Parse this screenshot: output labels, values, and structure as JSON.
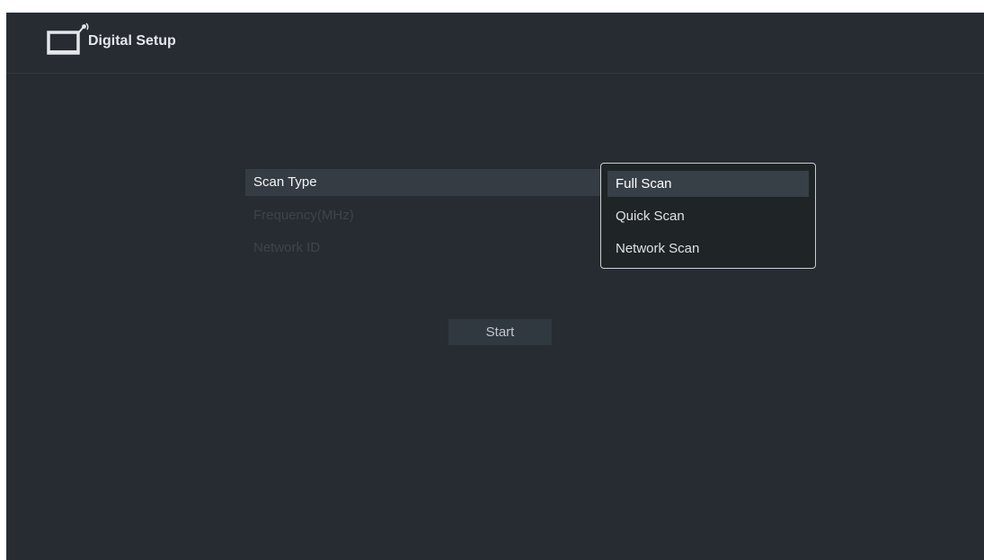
{
  "header": {
    "title": "Digital Setup",
    "icon": "tv-antenna-icon"
  },
  "menu": {
    "items": [
      {
        "label": "Scan Type",
        "state": "selected"
      },
      {
        "label": "Frequency(MHz)",
        "state": "disabled"
      },
      {
        "label": "Network ID",
        "state": "disabled"
      }
    ]
  },
  "dropdown": {
    "options": [
      {
        "label": "Full Scan",
        "selected": true
      },
      {
        "label": "Quick Scan",
        "selected": false
      },
      {
        "label": "Network Scan",
        "selected": false
      }
    ]
  },
  "start_button": {
    "label": "Start"
  },
  "colors": {
    "background": "#272c33",
    "selected_row": "#363c43",
    "dropdown_bg": "#1f2427",
    "dropdown_border": "#c9ced2"
  }
}
